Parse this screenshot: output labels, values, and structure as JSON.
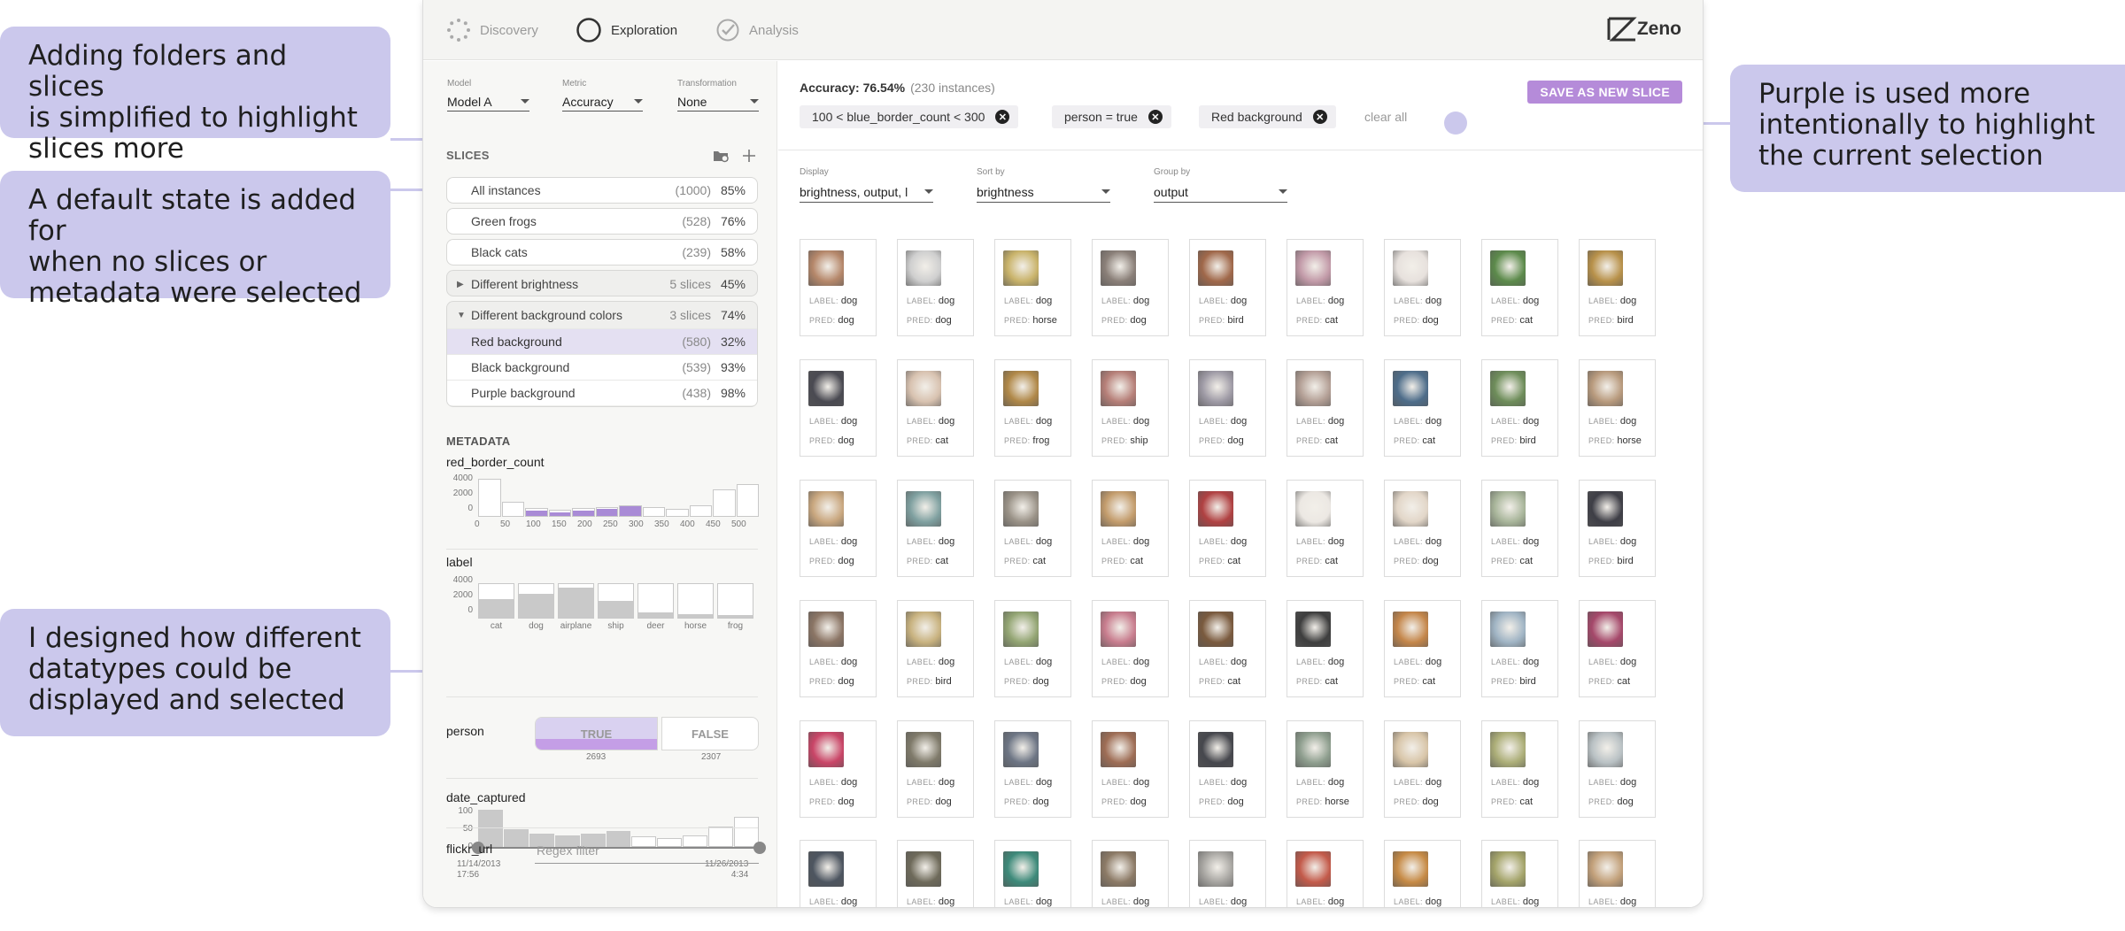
{
  "annotations": {
    "folders": [
      "Adding folders and slices",
      "is simplified to highlight",
      "slices more"
    ],
    "default_state": [
      "A default state is added for",
      "when no slices or",
      "metadata were selected"
    ],
    "datatypes": [
      "I designed how different",
      "datatypes could be",
      "displayed and selected"
    ],
    "purple": [
      "Purple is used more",
      "intentionally to highlight",
      "the current selection"
    ]
  },
  "nav": {
    "tabs": [
      "Discovery",
      "Exploration",
      "Analysis"
    ],
    "active": "Exploration",
    "logo": "Zeno"
  },
  "controls": {
    "model": {
      "label": "Model",
      "value": "Model A"
    },
    "metric": {
      "label": "Metric",
      "value": "Accuracy"
    },
    "transformation": {
      "label": "Transformation",
      "value": "None"
    }
  },
  "slices": {
    "title": "SLICES",
    "items": [
      {
        "name": "All instances",
        "count": "(1000)",
        "pct": "85%"
      },
      {
        "name": "Green frogs",
        "count": "(528)",
        "pct": "76%"
      },
      {
        "name": "Black cats",
        "count": "(239)",
        "pct": "58%"
      }
    ],
    "folders": [
      {
        "name": "Different brightness",
        "count": "5 slices",
        "pct": "45%",
        "expanded": false
      },
      {
        "name": "Different background colors",
        "count": "3 slices",
        "pct": "74%",
        "expanded": true,
        "children": [
          {
            "name": "Red background",
            "count": "(580)",
            "pct": "32%",
            "selected": true
          },
          {
            "name": "Black background",
            "count": "(539)",
            "pct": "93%"
          },
          {
            "name": "Purple background",
            "count": "(438)",
            "pct": "98%"
          }
        ]
      }
    ]
  },
  "metadata": {
    "title": "METADATA",
    "red_border_count": {
      "name": "red_border_count",
      "yticks": [
        "4000",
        "2000",
        "0"
      ],
      "xticks": [
        "0",
        "50",
        "100",
        "150",
        "200",
        "250",
        "300",
        "350",
        "400",
        "450",
        "500"
      ],
      "bins": [
        3800,
        1500,
        900,
        750,
        900,
        1000,
        1200,
        1000,
        800,
        1200,
        2800,
        3300
      ],
      "selected_bins": [
        0.7,
        0.55,
        0.75,
        0.85,
        0.95
      ]
    },
    "label": {
      "name": "label",
      "yticks": [
        "4000",
        "2000",
        "0"
      ],
      "categories": [
        "cat",
        "dog",
        "airplane",
        "ship",
        "deer",
        "horse",
        "frog"
      ],
      "totals": [
        3600,
        3600,
        3600,
        3600,
        3600,
        3600,
        3600
      ],
      "fills": [
        2000,
        2500,
        3200,
        1800,
        600,
        400,
        300
      ]
    },
    "person": {
      "name": "person",
      "true_label": "TRUE",
      "false_label": "FALSE",
      "true_count": "2693",
      "false_count": "2307",
      "selected": "TRUE"
    },
    "date_captured": {
      "name": "date_captured",
      "yticks": [
        "100",
        "50",
        "0"
      ],
      "bins": [
        100,
        47,
        35,
        30,
        35,
        43,
        28,
        25,
        30,
        55,
        82
      ],
      "range_start": [
        "11/14/2013",
        "17:56"
      ],
      "range_end": [
        "11/26/2013",
        "4:34"
      ]
    },
    "flickr_url": {
      "name": "flickr_url",
      "placeholder": "Regex filter"
    }
  },
  "header": {
    "accuracy_label": "Accuracy: 76.54%",
    "instances": "(230 instances)",
    "filters": [
      "100 < blue_border_count < 300",
      "person = true",
      "Red background"
    ],
    "clear_all": "clear all",
    "save_button": "SAVE AS NEW SLICE"
  },
  "view_controls": {
    "display": {
      "label": "Display",
      "value": "brightness, output, l"
    },
    "sort": {
      "label": "Sort by",
      "value": "brightness"
    },
    "group": {
      "label": "Group by",
      "value": "output"
    }
  },
  "card_keys": {
    "label": "LABEL:",
    "pred": "PRED:"
  },
  "thumb_colors": [
    "#b5876a",
    "#cfcfcf",
    "#c9b36a",
    "#8a7f78",
    "#a0684a",
    "#c29aa8",
    "#e7e1dd",
    "#5c8a4b",
    "#b8914a",
    "#4a4a52",
    "#d8c2b0",
    "#b08848",
    "#b67f78",
    "#9e9aa5",
    "#b39f95",
    "#4e6d8a",
    "#6e8d5a",
    "#b89a7d",
    "#c9a77f",
    "#7fa0a0",
    "#9a9287",
    "#c39c6c",
    "#b04142",
    "#ece8e3",
    "#e2d6c8",
    "#a8b59a",
    "#3e3e46",
    "#8b7565",
    "#c8b27f",
    "#93a573",
    "#c87d8e",
    "#7a5a3e",
    "#3e3e3e",
    "#c4864a",
    "#a0b4c4",
    "#a5486a",
    "#c94567",
    "#7f7a6a",
    "#6d7584",
    "#9e6d55",
    "#46474d",
    "#8e9e8e",
    "#d8c5a8",
    "#acae78",
    "#b9c1c4",
    "#4d5560",
    "#6e6a5a",
    "#3d8a7a",
    "#8c7a66",
    "#a6a4a0",
    "#c35a4a",
    "#c68a45",
    "#a4a46a",
    "#c2a07a"
  ],
  "cards": [
    {
      "l": "dog",
      "p": "dog"
    },
    {
      "l": "dog",
      "p": "dog"
    },
    {
      "l": "dog",
      "p": "horse"
    },
    {
      "l": "dog",
      "p": "dog"
    },
    {
      "l": "dog",
      "p": "bird"
    },
    {
      "l": "dog",
      "p": "cat"
    },
    {
      "l": "dog",
      "p": "dog"
    },
    {
      "l": "dog",
      "p": "cat"
    },
    {
      "l": "dog",
      "p": "bird"
    },
    {
      "l": "dog",
      "p": "dog"
    },
    {
      "l": "dog",
      "p": "cat"
    },
    {
      "l": "dog",
      "p": "frog"
    },
    {
      "l": "dog",
      "p": "ship"
    },
    {
      "l": "dog",
      "p": "dog"
    },
    {
      "l": "dog",
      "p": "cat"
    },
    {
      "l": "dog",
      "p": "cat"
    },
    {
      "l": "dog",
      "p": "bird"
    },
    {
      "l": "dog",
      "p": "horse"
    },
    {
      "l": "dog",
      "p": "dog"
    },
    {
      "l": "dog",
      "p": "cat"
    },
    {
      "l": "dog",
      "p": "cat"
    },
    {
      "l": "dog",
      "p": "cat"
    },
    {
      "l": "dog",
      "p": "cat"
    },
    {
      "l": "dog",
      "p": "cat"
    },
    {
      "l": "dog",
      "p": "dog"
    },
    {
      "l": "dog",
      "p": "cat"
    },
    {
      "l": "dog",
      "p": "bird"
    },
    {
      "l": "dog",
      "p": "dog"
    },
    {
      "l": "dog",
      "p": "bird"
    },
    {
      "l": "dog",
      "p": "dog"
    },
    {
      "l": "dog",
      "p": "dog"
    },
    {
      "l": "dog",
      "p": "cat"
    },
    {
      "l": "dog",
      "p": "cat"
    },
    {
      "l": "dog",
      "p": "cat"
    },
    {
      "l": "dog",
      "p": "bird"
    },
    {
      "l": "dog",
      "p": "cat"
    },
    {
      "l": "dog",
      "p": "dog"
    },
    {
      "l": "dog",
      "p": "dog"
    },
    {
      "l": "dog",
      "p": "dog"
    },
    {
      "l": "dog",
      "p": "dog"
    },
    {
      "l": "dog",
      "p": "dog"
    },
    {
      "l": "dog",
      "p": "horse"
    },
    {
      "l": "dog",
      "p": "dog"
    },
    {
      "l": "dog",
      "p": "cat"
    },
    {
      "l": "dog",
      "p": "dog"
    },
    {
      "l": "dog",
      "p": ""
    },
    {
      "l": "dog",
      "p": ""
    },
    {
      "l": "dog",
      "p": ""
    },
    {
      "l": "dog",
      "p": ""
    },
    {
      "l": "dog",
      "p": ""
    },
    {
      "l": "dog",
      "p": ""
    },
    {
      "l": "dog",
      "p": ""
    },
    {
      "l": "dog",
      "p": ""
    },
    {
      "l": "dog",
      "p": ""
    }
  ]
}
